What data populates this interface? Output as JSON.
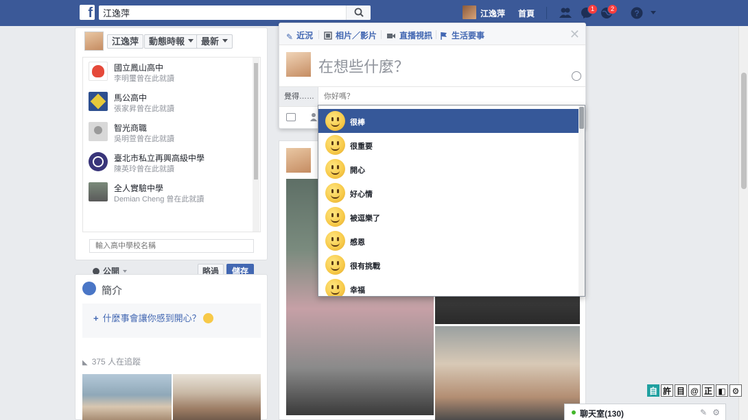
{
  "header": {
    "logo": "f",
    "search_value": "江逸萍",
    "user_name": "江逸萍",
    "home_label": "首頁",
    "friend_requests_count": "",
    "messages_count": "1",
    "notifications_count": "2"
  },
  "left": {
    "user_name": "江逸萍",
    "filter_timeline": "動態時報",
    "filter_latest": "最新",
    "schools": [
      {
        "name": "國立鳳山高中",
        "sub": "李明璽曾在此就讀",
        "color": "#e5493a"
      },
      {
        "name": "馬公高中",
        "sub": "張家昇曾在此就讀",
        "color": "#2d4f8f"
      },
      {
        "name": "智光商職",
        "sub": "吳明萱曾在此就讀",
        "color": "#c8c8c8"
      },
      {
        "name": "臺北市私立再興高級中學",
        "sub": "陳英玲曾在此就讀",
        "color": "#39357a"
      },
      {
        "name": "全人實驗中學",
        "sub": "Demian Cheng 曾在此就讀",
        "color": "#8a8a8a"
      }
    ],
    "school_placeholder": "輸入高中學校名稱",
    "privacy_label": "公開",
    "skip_label": "略過",
    "save_label": "儲存",
    "intro_title": "簡介",
    "intro_prompt": "什麼事會讓你感到開心？",
    "followers": "375 人在追蹤"
  },
  "composer": {
    "tab_status": "近況",
    "tab_photo": "相片／影片",
    "tab_live": "直播視訊",
    "tab_event": "生活要事",
    "prompt": "在想些什麼？",
    "feeling_label": "覺得……",
    "feeling_placeholder": "你好嗎？"
  },
  "feelings": [
    {
      "label": "很棒",
      "selected": true
    },
    {
      "label": "很重要",
      "selected": false
    },
    {
      "label": "開心",
      "selected": false
    },
    {
      "label": "好心情",
      "selected": false
    },
    {
      "label": "被逗樂了",
      "selected": false
    },
    {
      "label": "感恩",
      "selected": false
    },
    {
      "label": "很有挑戰",
      "selected": false
    },
    {
      "label": "幸福",
      "selected": false
    }
  ],
  "ime": [
    "自",
    "許",
    "目",
    "@",
    "正",
    "◧",
    "⚙"
  ],
  "chat": {
    "label": "聊天室(130)"
  },
  "colors": {
    "brand": "#3b5998",
    "link": "#4267b2",
    "selected": "#365899"
  }
}
